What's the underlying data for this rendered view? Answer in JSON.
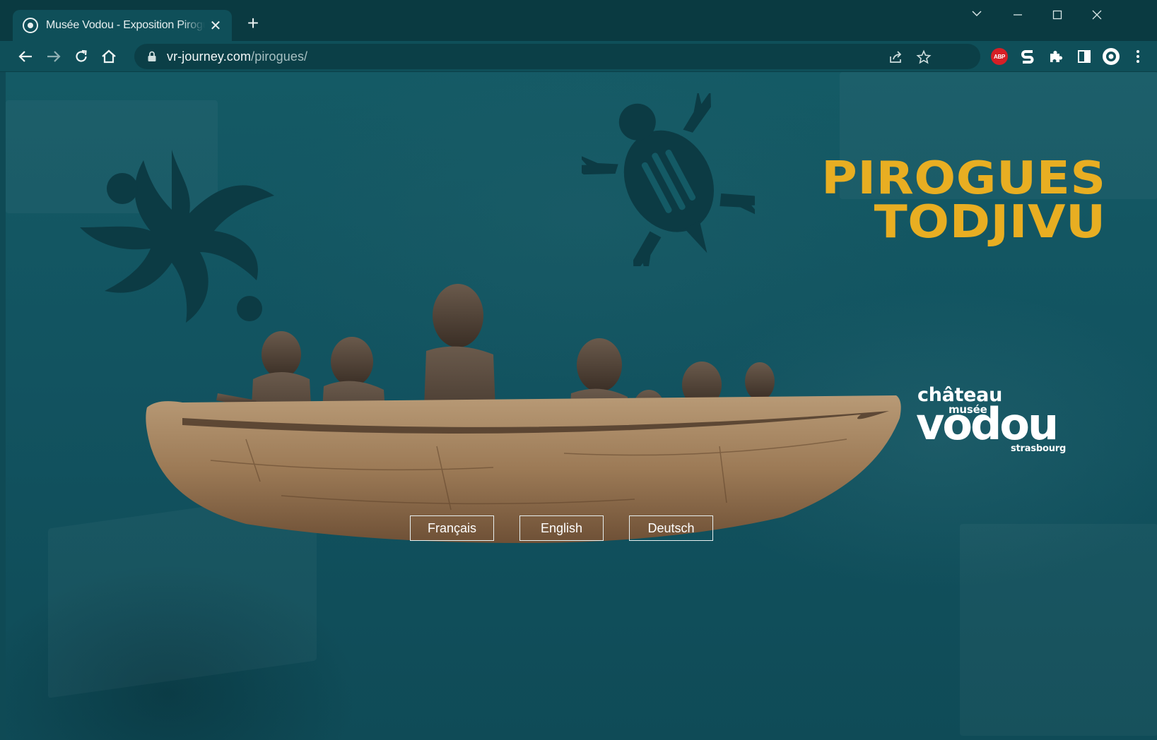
{
  "browser": {
    "tab_title": "Musée Vodou - Exposition Pirogues",
    "url_domain": "vr-journey.com",
    "url_path": "/pirogues/",
    "extensions": [
      "abp-icon",
      "s-extension-icon",
      "puzzle-icon",
      "sidepanel-icon",
      "profile-icon"
    ],
    "abp_label": "ABP",
    "accent": "#0f4f59"
  },
  "page": {
    "title_line1": "PIROGUES",
    "title_line2": "TODJIVU",
    "title_color": "#e8ae22",
    "logo": {
      "line1": "château",
      "line2": "musée",
      "line3": "vodou",
      "line4": "strasbourg"
    },
    "languages": [
      "Français",
      "English",
      "Deutsch"
    ]
  }
}
